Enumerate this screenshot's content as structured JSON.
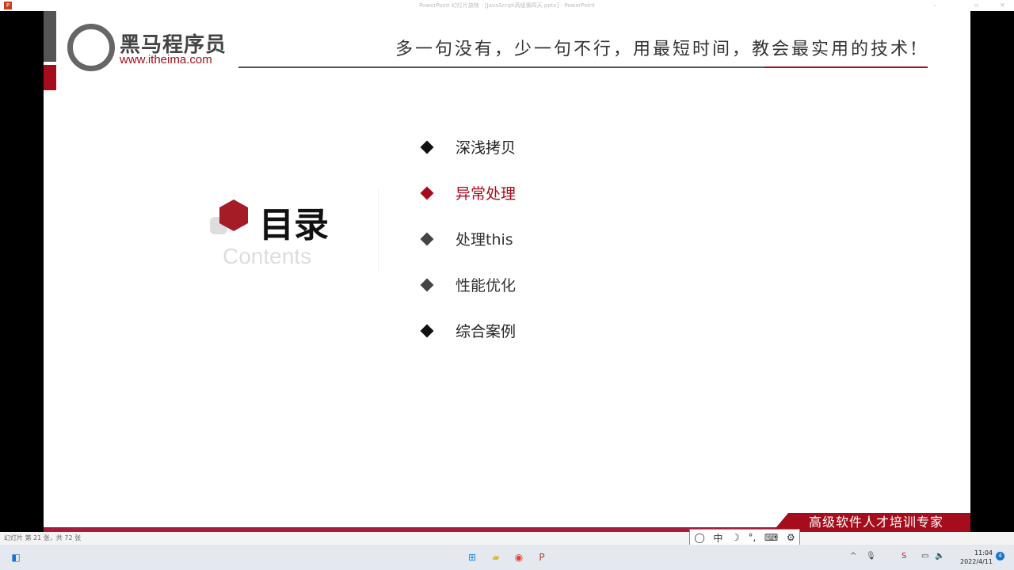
{
  "window": {
    "title": "PowerPoint 幻灯片放映 - [JavaScript高级第四天.pptx] - PowerPoint"
  },
  "slide": {
    "logo": {
      "name": "黑马程序员",
      "url": "www.itheima.com"
    },
    "slogan": "多一句没有，少一句不行，用最短时间，教会最实用的技术!",
    "toc_title": "目录",
    "toc_subtitle": "Contents",
    "items": [
      {
        "label": "深浅拷贝"
      },
      {
        "label": "异常处理"
      },
      {
        "label": "处理this"
      },
      {
        "label": "性能优化"
      },
      {
        "label": "综合案例"
      }
    ],
    "footer": "高级软件人才培训专家"
  },
  "status": {
    "slide_count": "幻灯片 第 21 张，共 72 张"
  },
  "ime": {
    "mode": "中"
  },
  "taskbar": {
    "time": "11:04",
    "date": "2022/4/11",
    "notifications": "4"
  },
  "colors": {
    "accent": "#a50d1c"
  }
}
